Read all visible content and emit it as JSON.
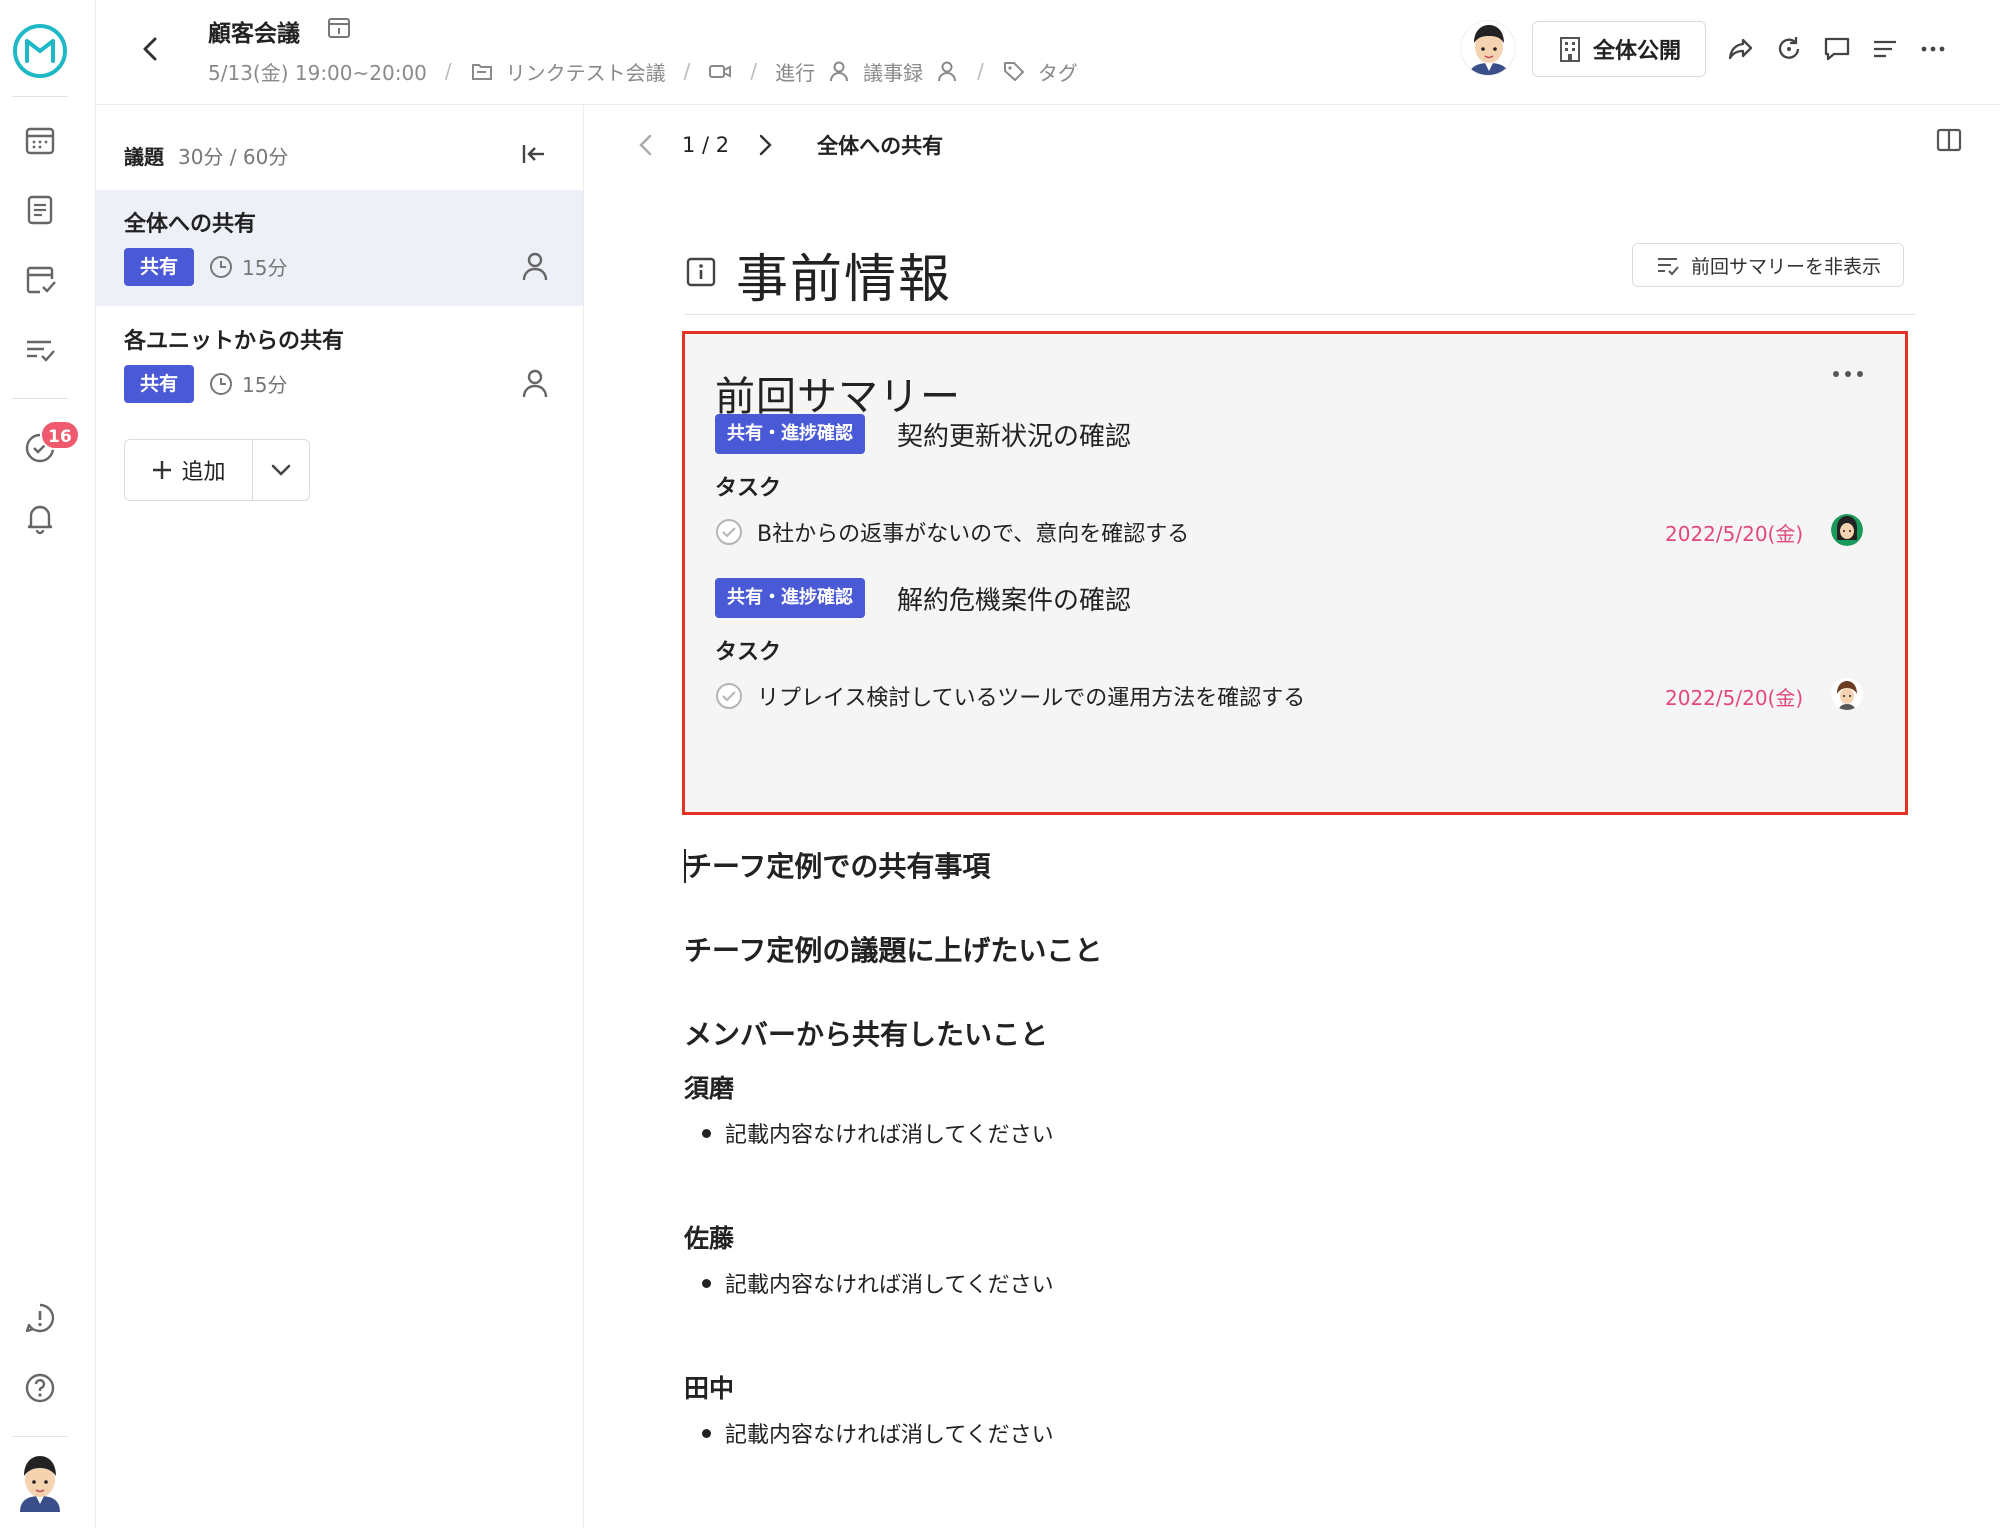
{
  "rail": {
    "badge_count": "16"
  },
  "header": {
    "title": "顧客会議",
    "datetime": "5/13(金) 19:00~20:00",
    "folder": "リンクテスト会議",
    "progress_label": "進行",
    "minutes_label": "議事録",
    "tag_label": "タグ",
    "publish_label": "全体公開"
  },
  "agenda": {
    "heading": "議題",
    "time_summary": "30分 / 60分",
    "items": [
      {
        "title": "全体への共有",
        "badge": "共有",
        "duration": "15分"
      },
      {
        "title": "各ユニットからの共有",
        "badge": "共有",
        "duration": "15分"
      }
    ],
    "add_label": "追加"
  },
  "main": {
    "pager": "1 / 2",
    "current_title": "全体への共有",
    "section_title": "事前情報",
    "hide_summary_label": "前回サマリーを非表示",
    "summary": {
      "title": "前回サマリー",
      "topics": [
        {
          "tag": "共有・進捗確認",
          "title": "契約更新状況の確認",
          "task_label": "タスク",
          "task": "B社からの返事がないので、意向を確認する",
          "due": "2022/5/20(金)"
        },
        {
          "tag": "共有・進捗確認",
          "title": "解約危機案件の確認",
          "task_label": "タスク",
          "task": "リプレイス検討しているツールでの運用方法を確認する",
          "due": "2022/5/20(金)"
        }
      ]
    },
    "doc": {
      "h1": "チーフ定例での共有事項",
      "h2": "チーフ定例の議題に上げたいこと",
      "h3": "メンバーから共有したいこと",
      "members": [
        {
          "name": "須磨",
          "note": "記載内容なければ消してください"
        },
        {
          "name": "佐藤",
          "note": "記載内容なければ消してください"
        },
        {
          "name": "田中",
          "note": "記載内容なければ消してください"
        }
      ]
    }
  }
}
